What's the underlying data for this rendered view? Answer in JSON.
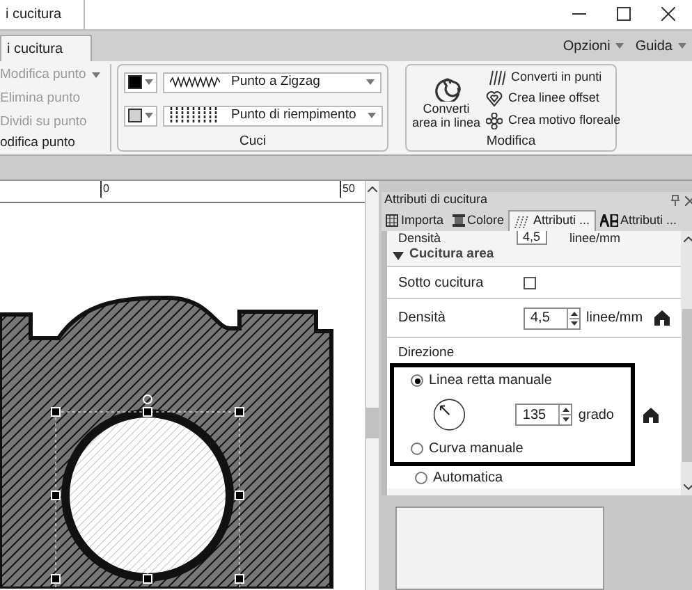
{
  "window": {
    "title_tab": "i cucitura"
  },
  "ribbon": {
    "tab": "i cucitura",
    "menus": [
      "Opzioni",
      "Guida"
    ],
    "group_edit": {
      "label": "odifica punto",
      "items": [
        {
          "label": "Modifica punto",
          "kind": "dropdown",
          "disabled": true
        },
        {
          "label": "Elimina punto",
          "kind": "plain",
          "disabled": true
        },
        {
          "label": "Dividi su punto",
          "kind": "plain",
          "disabled": true
        }
      ]
    },
    "group_sew": {
      "label": "Cuci",
      "rows": [
        {
          "kind": "zigzag",
          "label": "Punto a Zigzag",
          "color": "#000000"
        },
        {
          "kind": "fill",
          "label": "Punto di riempimento",
          "color": "#d0d0d0"
        }
      ]
    },
    "group_modify": {
      "label": "Modifica",
      "big": "Converti\narea in linea",
      "items": [
        {
          "kind": "lines",
          "label": "Converti in punti"
        },
        {
          "kind": "heart",
          "label": "Crea linee offset"
        },
        {
          "kind": "flower",
          "label": "Crea motivo floreale"
        }
      ]
    }
  },
  "ruler": {
    "labels": [
      "0",
      "50"
    ]
  },
  "panel": {
    "title": "Attributi di cucitura",
    "tabs": [
      {
        "label": "Importa",
        "selected": false
      },
      {
        "label": "Colore",
        "selected": false
      },
      {
        "label": "Attributi ...",
        "selected": true
      },
      {
        "label": "Attributi ...",
        "selected": false
      }
    ],
    "prev_row": {
      "label": "Densità",
      "value": "4,5",
      "unit": "linee/mm"
    },
    "section": {
      "title": "Cucitura area",
      "expanded": true
    },
    "under": {
      "label": "Sotto cucitura",
      "checked": false
    },
    "density": {
      "label": "Densità",
      "value": "4,5",
      "unit": "linee/mm"
    },
    "direction": {
      "label": "Direzione",
      "options": [
        {
          "label": "Linea retta manuale",
          "selected": true
        },
        {
          "label": "Curva manuale",
          "selected": false
        },
        {
          "label": "Automatica",
          "selected": false
        }
      ],
      "angle": "135",
      "angle_unit": "grado"
    }
  }
}
